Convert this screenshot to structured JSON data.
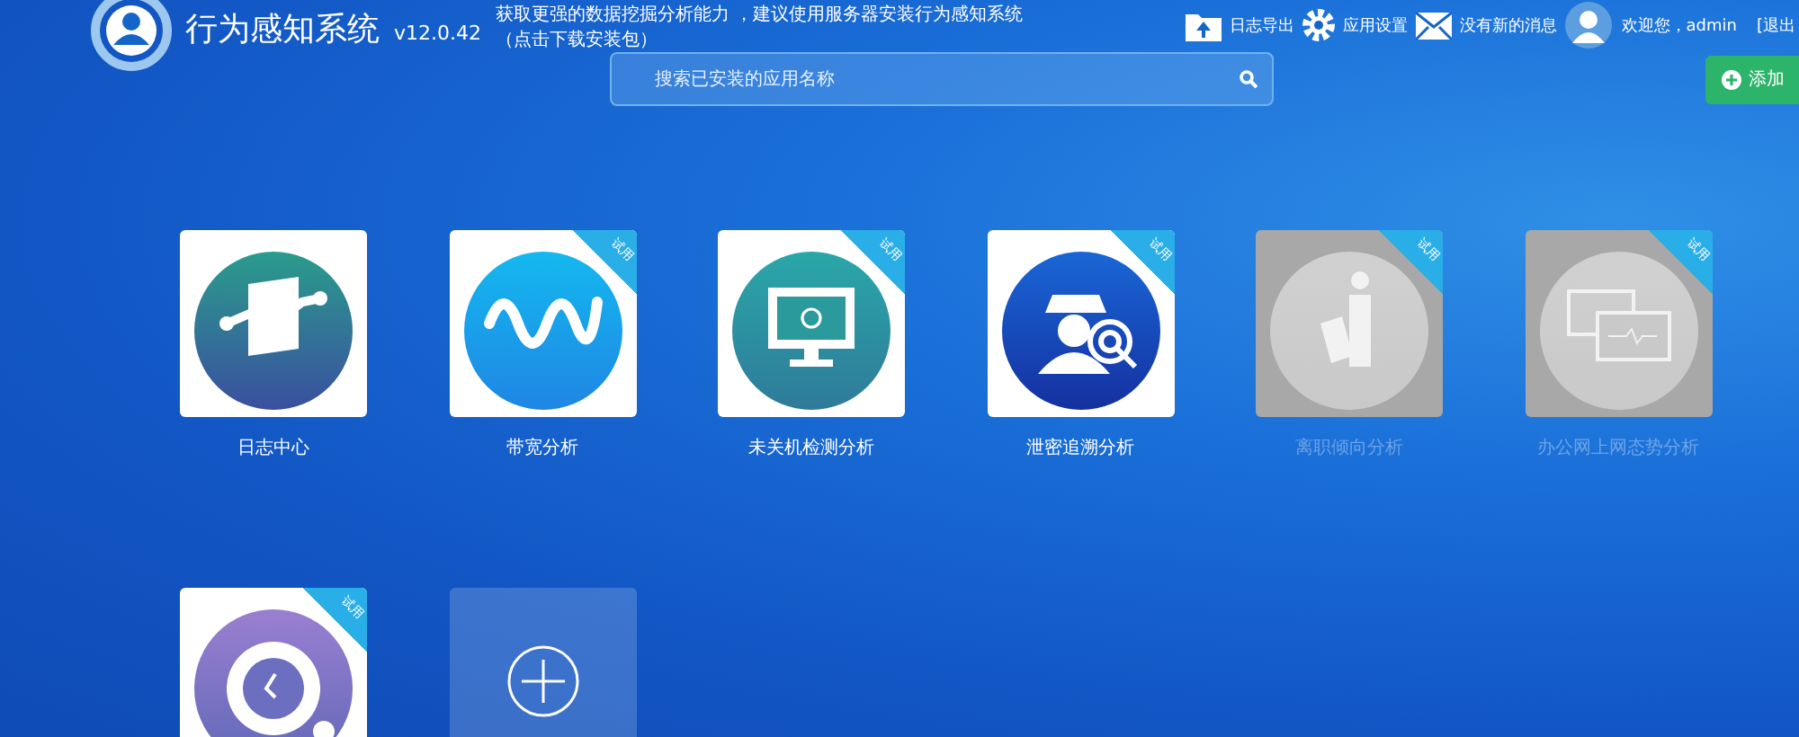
{
  "header": {
    "title": "行为感知系统",
    "version": "v12.0.42",
    "notice_lines": [
      "获取更强的数据挖掘分析能力 ，建议使用服务器安装行为感知系统",
      "（点击下载安装包）"
    ],
    "actions": [
      {
        "kind": "export",
        "label": "日志导出"
      },
      {
        "kind": "settings",
        "label": "应用设置"
      },
      {
        "kind": "messages",
        "label": "没有新的消息"
      }
    ],
    "user": {
      "greeting": "欢迎您，admin",
      "logout": "[退出"
    }
  },
  "search": {
    "placeholder": "搜索已安装的应用名称"
  },
  "add_button": {
    "label": "添加"
  },
  "apps": [
    {
      "kind": "log",
      "name": "日志中心",
      "disabled": false
    },
    {
      "kind": "wave",
      "name": "带宽分析",
      "disabled": false,
      "badge": "试用"
    },
    {
      "kind": "monitor",
      "name": "未关机检测分析",
      "disabled": false,
      "badge": "试用"
    },
    {
      "kind": "spy",
      "name": "泄密追溯分析",
      "disabled": false,
      "badge": "试用"
    },
    {
      "kind": "trash",
      "name": "离职倾向分析",
      "disabled": true,
      "badge": "试用"
    },
    {
      "kind": "screens",
      "name": "办公网上网态势分析",
      "disabled": true,
      "badge": "试用"
    },
    {
      "kind": "clock",
      "disabled": false,
      "badge": "试用"
    },
    {
      "kind": "add"
    }
  ]
}
